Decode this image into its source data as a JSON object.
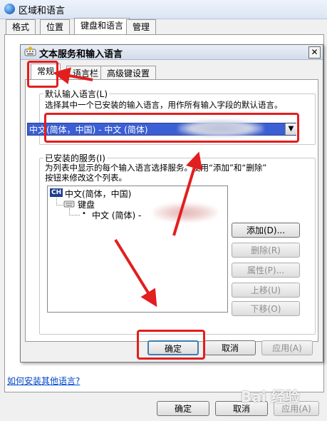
{
  "outer_window": {
    "title": "区域和语言",
    "tabs": [
      "格式",
      "位置",
      "键盘和语言",
      "管理"
    ],
    "active_tab": "键盘和语言",
    "buttons": {
      "ok": "确定",
      "cancel": "取消",
      "apply": "应用(A)"
    }
  },
  "dialog": {
    "title": "文本服务和输入语言",
    "close_label": "✕",
    "tabs": [
      "常规",
      "语言栏",
      "高级键设置"
    ],
    "active_tab": "常规",
    "default_language": {
      "group_label": "默认输入语言(L)",
      "description": "选择其中一个已安装的输入语言，用作所有输入字段的默认语言。",
      "selected_value": "中文(简体，中国) - 中文 (简体)"
    },
    "installed_services": {
      "group_label": "已安装的服务(I)",
      "description_line1": "为列表中显示的每个输入语言选择服务。使用“添加”和“删除”",
      "description_line2": "按钮来修改这个列表。",
      "tree": {
        "language_badge": "CH",
        "language": "中文(简体，中国)",
        "category": "键盘",
        "service": "中文 (简体) -"
      },
      "buttons": {
        "add": "添加(D)...",
        "remove": "删除(R)",
        "properties": "属性(P)...",
        "move_up": "上移(U)",
        "move_down": "下移(O)"
      }
    },
    "footer_buttons": {
      "ok": "确定",
      "cancel": "取消",
      "apply": "应用(A)"
    }
  },
  "help_link": "如何安装其他语言?",
  "watermark": "Bai 经验"
}
